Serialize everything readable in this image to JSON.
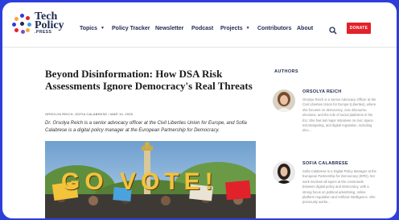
{
  "colors": {
    "frame": "#2d3edb",
    "brand_navy": "#1f2a4e",
    "donate_red": "#e2222a"
  },
  "site": {
    "logo_line1": "Tech",
    "logo_line2": "Policy",
    "logo_press": ".PRESS"
  },
  "nav": {
    "items": [
      {
        "label": "Topics",
        "dropdown": true
      },
      {
        "label": "Policy Tracker",
        "dropdown": false
      },
      {
        "label": "Newsletter",
        "dropdown": false
      },
      {
        "label": "Podcast",
        "dropdown": false
      },
      {
        "label": "Projects",
        "dropdown": true
      },
      {
        "label": "Contributors",
        "dropdown": false
      },
      {
        "label": "About",
        "dropdown": false
      }
    ],
    "search_icon": "search-icon",
    "donate_label": "DONATE"
  },
  "article": {
    "title": "Beyond Disinformation: How DSA Risk Assessments Ignore Democracy's Real Threats",
    "byline": "ORSOLYA REICH, SOFIA CALABRESE / MAR 19, 2025",
    "intro": "Dr. Orsolya Reich is a senior advocacy officer at the Civil Liberties Union for Europe, and Sofia Calabrese is a digital policy manager at the European Partnership for Democracy.",
    "image_text": "GO VOTE!"
  },
  "sidebar": {
    "heading": "AUTHORS",
    "authors": [
      {
        "name": "ORSOLYA REICH",
        "bio": "Orsolya Reich is a Senior Advocacy Officer at the Civil Liberties Union for Europe (Liberties), where she focuses on democracy, civic discourse, elections, and the role of social platforms in the EU. She has led major initiatives on civic space, microtargeting, and digital regulation, including elec..."
      },
      {
        "name": "SOFIA CALABRESE",
        "bio": "Sofia Calabrese is a Digital Policy Manager at the European Partnership for Democracy (EPD), her work involves all topics at the crossroads between digital policy and democracy, with a strong focus on political advertising, online platform regulation and Artificial Intelligence. She previously worke..."
      }
    ]
  }
}
